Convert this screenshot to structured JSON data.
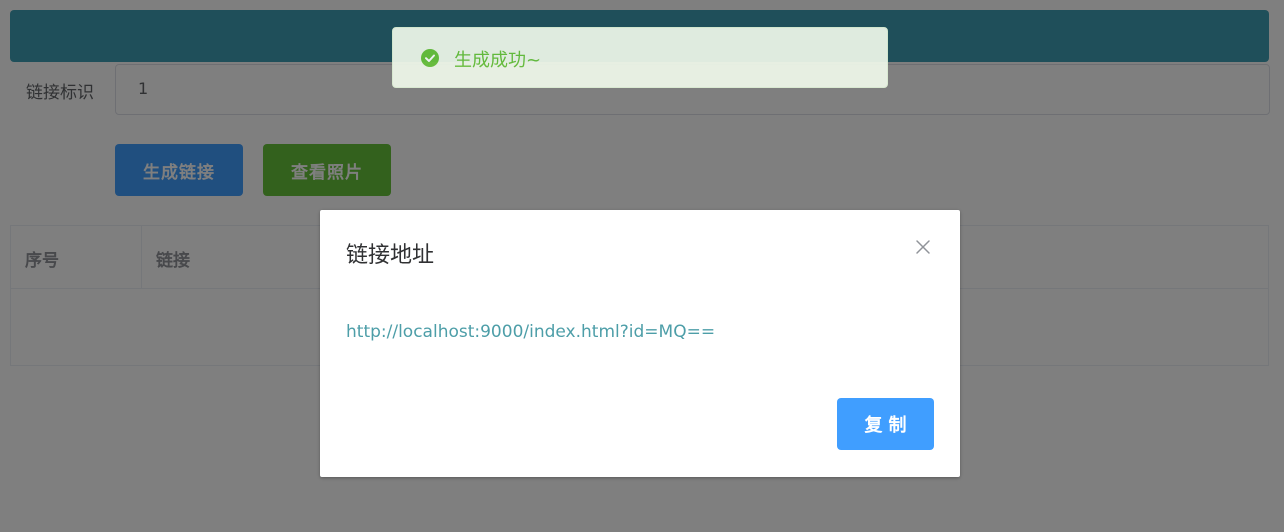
{
  "form": {
    "label": "链接标识",
    "input_value": "1"
  },
  "buttons": {
    "generate_label": "生成链接",
    "view_label": "查看照片"
  },
  "table": {
    "columns": [
      "序号",
      "链接"
    ]
  },
  "toast": {
    "icon": "success-check-icon",
    "text": "生成成功~"
  },
  "dialog": {
    "title": "链接地址",
    "url": "http://localhost:9000/index.html?id=MQ==",
    "copy_label": "复制",
    "close_icon": "close-icon"
  },
  "colors": {
    "header": "#3f9fb4",
    "primary": "#409eff",
    "success": "#67c23a",
    "link_text": "#4d9ea8"
  }
}
